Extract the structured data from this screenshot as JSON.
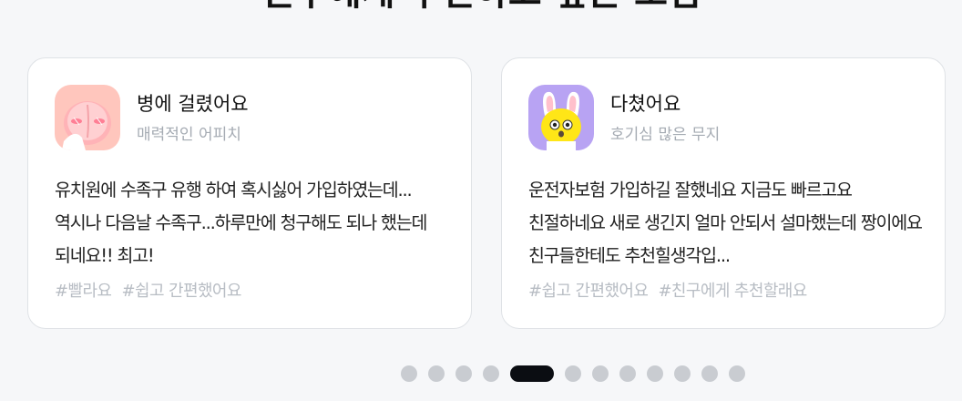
{
  "section": {
    "title": "친구에게 추천하고 싶은 보험"
  },
  "reviews": [
    {
      "author_title": "병에 걸렸어요",
      "author_name": "매력적인 어피치",
      "body": "유치원에 수족구 유행 하여 혹시싫어 가입하였는데...역시나 다음날 수족구...하루만에 청구해도 되나 했는데 되네요!! 최고!",
      "tags": [
        "#빨라요",
        "#쉽고 간편했어요"
      ],
      "avatar": "peach-character-icon"
    },
    {
      "author_title": "다쳤어요",
      "author_name": "호기심 많은 무지",
      "body": "운전자보험 가입하길 잘했네요 지금도 빠르고요 친절하네요 새로 생긴지 얼마 안되서 설마했는데 짱이에요 친구들한테도 추천힐생각입...",
      "tags": [
        "#쉽고 간편했어요",
        "#친구에게 추천할래요"
      ],
      "avatar": "muzi-character-icon"
    }
  ],
  "pagination": {
    "total": 12,
    "active_index": 4
  },
  "colors": {
    "background": "#f6f7f9",
    "card_border": "#dfe2e6",
    "tag": "#b8bdc4",
    "dot_inactive": "#c9ccd1",
    "dot_active": "#0b0d12"
  }
}
